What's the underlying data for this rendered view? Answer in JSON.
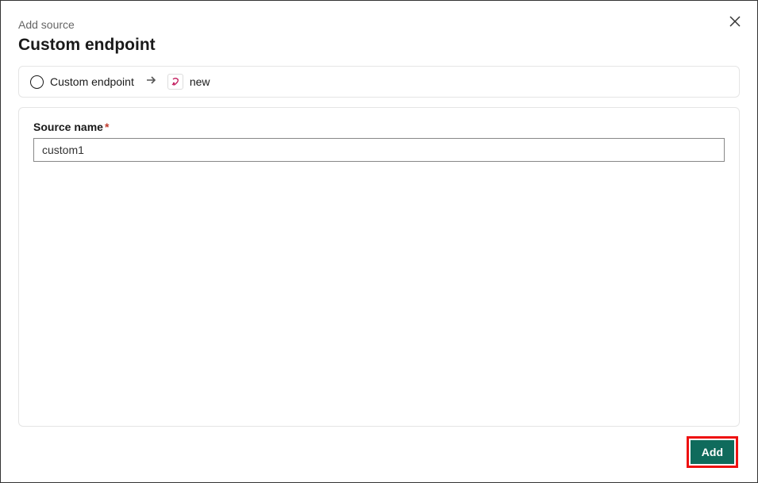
{
  "header": {
    "subtitle": "Add source",
    "title": "Custom endpoint"
  },
  "breadcrumb": {
    "step1_label": "Custom endpoint",
    "step2_label": "new"
  },
  "form": {
    "source_name_label": "Source name",
    "source_name_value": "custom1"
  },
  "footer": {
    "add_button_label": "Add"
  }
}
